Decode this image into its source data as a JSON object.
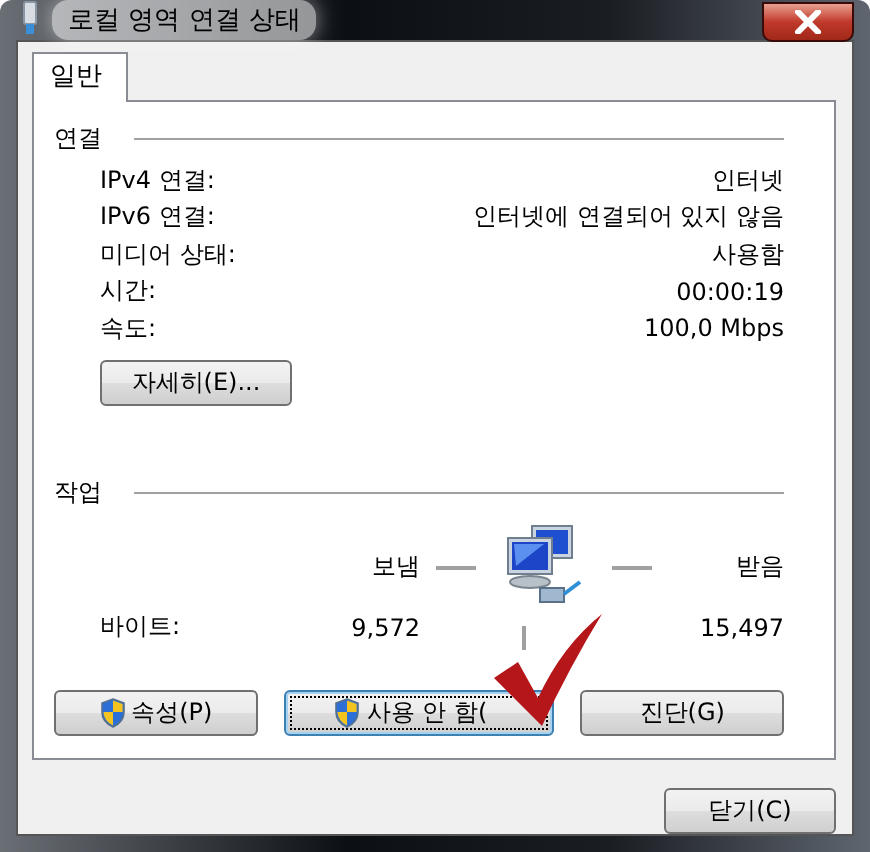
{
  "window": {
    "title": "로컬 영역 연결 상태"
  },
  "tabs": [
    {
      "label": "일반",
      "selected": true
    }
  ],
  "connection": {
    "heading": "연결",
    "rows": [
      {
        "label": "IPv4 연결:",
        "value": "인터넷"
      },
      {
        "label": "IPv6 연결:",
        "value": "인터넷에 연결되어 있지 않음"
      },
      {
        "label": "미디어 상태:",
        "value": "사용함"
      },
      {
        "label": "시간:",
        "value": "00:00:19"
      },
      {
        "label": "속도:",
        "value": "100,0 Mbps"
      }
    ],
    "details_button": "자세히(E)..."
  },
  "activity": {
    "heading": "작업",
    "sent_label": "보냄",
    "received_label": "받음",
    "bytes_label": "바이트:",
    "bytes_sent": "9,572",
    "bytes_received": "15,497"
  },
  "action_buttons": [
    {
      "label": "속성(P)",
      "shield": true,
      "focused": false
    },
    {
      "label": "사용 안 함(",
      "shield": true,
      "focused": true
    },
    {
      "label": "진단(G)",
      "shield": false,
      "focused": false
    }
  ],
  "check_mark_annotation": true,
  "close_button": "닫기(C)"
}
